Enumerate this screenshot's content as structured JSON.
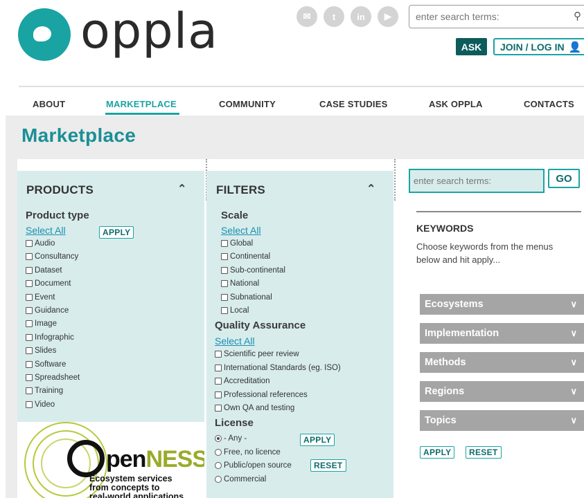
{
  "brand": {
    "logo_text": "oppla",
    "accent": "#1aa3a3"
  },
  "social": [
    "envelope-icon",
    "twitter-icon",
    "linkedin-icon",
    "youtube-icon"
  ],
  "header": {
    "search_placeholder": "enter search terms:",
    "ask_label": "ASK",
    "join_label": "JOIN / LOG IN"
  },
  "nav": {
    "items": [
      "ABOUT",
      "MARKETPLACE",
      "COMMUNITY",
      "CASE STUDIES",
      "ASK OPPLA",
      "CONTACTS"
    ],
    "active": "MARKETPLACE"
  },
  "page_title": "Marketplace",
  "products": {
    "heading": "PRODUCTS",
    "section_label": "Product type",
    "select_all": "Select All",
    "apply": "APPLY",
    "items": [
      "Audio",
      "Consultancy",
      "Dataset",
      "Document",
      "Event",
      "Guidance",
      "Image",
      "Infographic",
      "Slides",
      "Software",
      "Spreadsheet",
      "Training",
      "Video"
    ]
  },
  "filters": {
    "heading": "FILTERS",
    "scale": {
      "label": "Scale",
      "select_all": "Select All",
      "items": [
        "Global",
        "Continental",
        "Sub-continental",
        "National",
        "Subnational",
        "Local"
      ]
    },
    "qa": {
      "label": "Quality Assurance",
      "select_all": "Select All",
      "items": [
        "Scientific peer review",
        "International Standards (eg. ISO)",
        "Accreditation",
        "Professional references",
        "Own QA and testing"
      ]
    },
    "license": {
      "label": "License",
      "apply": "APPLY",
      "reset": "RESET",
      "options": [
        "- Any -",
        "Free, no licence",
        "Public/open source",
        "Commercial"
      ],
      "selected": "- Any -"
    }
  },
  "openness_logo": {
    "word_o": "O",
    "word_pen": "pen",
    "word_ness": "NESS",
    "tagline": [
      "Ecosystem services",
      "from concepts to",
      "real-world applications"
    ]
  },
  "keywords": {
    "search_placeholder": "enter search terms:",
    "go_label": "GO",
    "title": "KEYWORDS",
    "description": "Choose keywords from the menus below and hit apply...",
    "accordions": [
      "Ecosystems",
      "Implementation",
      "Methods",
      "Regions",
      "Topics"
    ],
    "apply": "APPLY",
    "reset": "RESET"
  }
}
